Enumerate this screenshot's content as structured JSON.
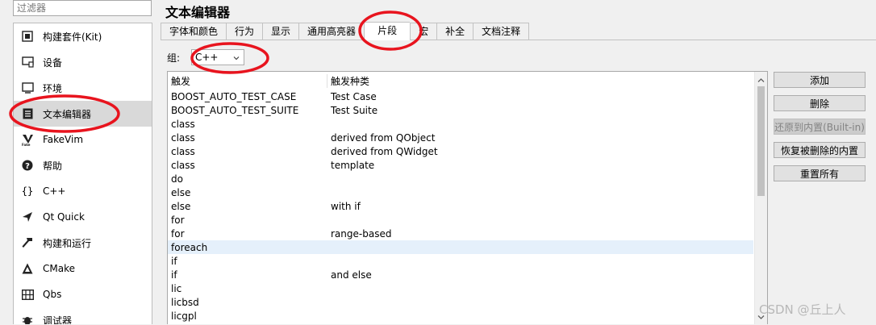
{
  "filter": {
    "placeholder": "过滤器"
  },
  "sidebar": {
    "items": [
      {
        "label": "构建套件(Kit)",
        "icon": "kit-icon"
      },
      {
        "label": "设备",
        "icon": "device-icon"
      },
      {
        "label": "环境",
        "icon": "environment-icon"
      },
      {
        "label": "文本编辑器",
        "icon": "text-editor-icon",
        "selected": true
      },
      {
        "label": "FakeVim",
        "icon": "fakevim-icon"
      },
      {
        "label": "帮助",
        "icon": "help-icon"
      },
      {
        "label": "C++",
        "icon": "cpp-icon",
        "glyph": "{}"
      },
      {
        "label": "Qt Quick",
        "icon": "qt-quick-icon"
      },
      {
        "label": "构建和运行",
        "icon": "build-run-icon"
      },
      {
        "label": "CMake",
        "icon": "cmake-icon"
      },
      {
        "label": "Qbs",
        "icon": "qbs-icon"
      },
      {
        "label": "调试器",
        "icon": "debugger-icon"
      }
    ]
  },
  "header": {
    "title": "文本编辑器"
  },
  "tabs": [
    {
      "label": "字体和颜色"
    },
    {
      "label": "行为"
    },
    {
      "label": "显示"
    },
    {
      "label": "通用高亮器"
    },
    {
      "label": "片段",
      "active": true
    },
    {
      "label": "宏"
    },
    {
      "label": "补全"
    },
    {
      "label": "文档注释"
    }
  ],
  "group": {
    "label": "组:",
    "value": "C++"
  },
  "table": {
    "columns": [
      "触发",
      "触发种类"
    ],
    "rows": [
      [
        "BOOST_AUTO_TEST_CASE",
        "Test Case"
      ],
      [
        "BOOST_AUTO_TEST_SUITE",
        "Test Suite"
      ],
      [
        "class",
        ""
      ],
      [
        "class",
        "derived from QObject"
      ],
      [
        "class",
        "derived from QWidget"
      ],
      [
        "class",
        "template"
      ],
      [
        "do",
        ""
      ],
      [
        "else",
        ""
      ],
      [
        "else",
        "with if"
      ],
      [
        "for",
        ""
      ],
      [
        "for",
        "range-based"
      ],
      [
        "foreach",
        ""
      ],
      [
        "if",
        ""
      ],
      [
        "if",
        "and else"
      ],
      [
        "lic",
        ""
      ],
      [
        "licbsd",
        ""
      ],
      [
        "licgpl",
        ""
      ]
    ],
    "highlighted_row": 11
  },
  "buttons": {
    "add": "添加",
    "remove": "删除",
    "revert_builtin": "还原到内置(Built-in)",
    "restore_removed": "恢复被删除的内置",
    "reset_all": "重置所有"
  },
  "watermark": "CSDN @丘上人",
  "colors": {
    "annotation_red": "#e8141e",
    "selection": "#d9d9d9",
    "row_highlight": "#e5f0fb"
  }
}
